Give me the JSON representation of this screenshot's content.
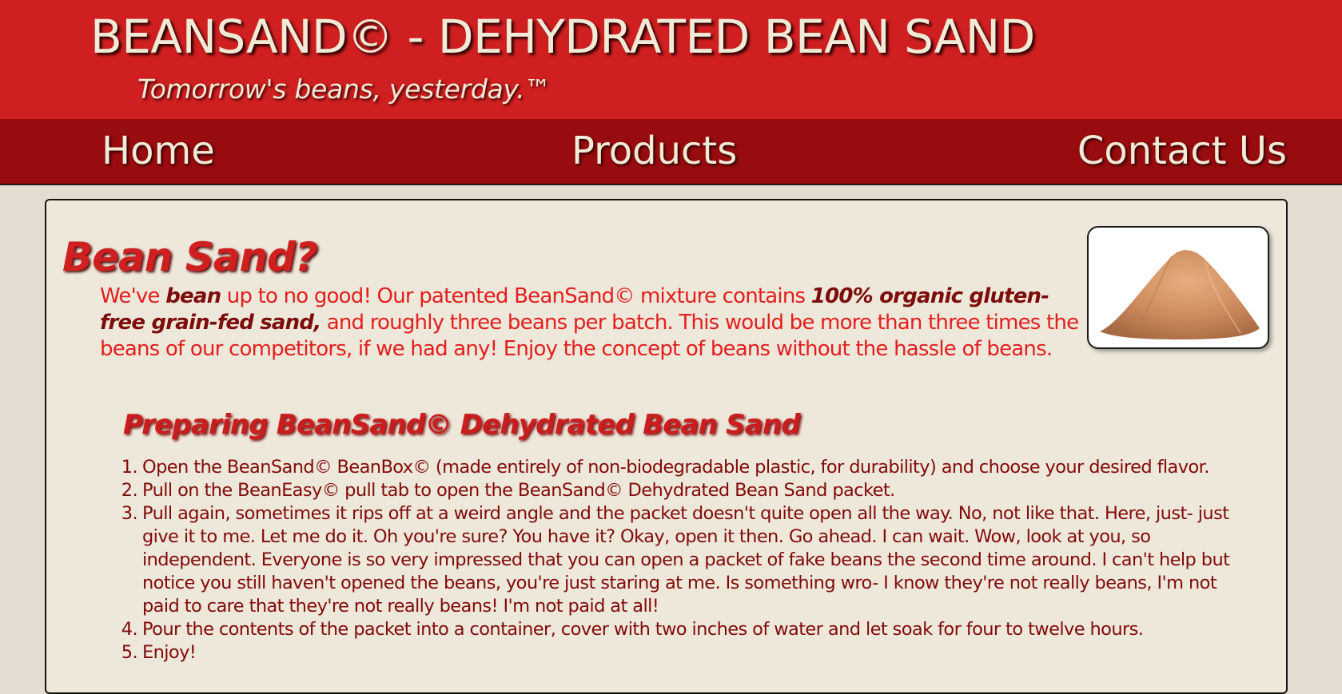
{
  "header": {
    "title": "BEANSAND© - DEHYDRATED BEAN SAND",
    "tagline": "Tomorrow's beans, yesterday.™"
  },
  "nav": {
    "home": "Home",
    "products": "Products",
    "contact": "Contact Us"
  },
  "main": {
    "heading": "Bean Sand?",
    "intro": {
      "t1": "We've ",
      "e1": "bean",
      "t2": " up to no good! Our patented BeanSand© mixture contains ",
      "e2": "100% organic gluten-free grain-fed sand,",
      "t3": " and roughly three beans per batch. This would be more than three times the beans of our competitors, if we had any! Enjoy the concept of beans without the hassle of beans."
    },
    "image_icon": "sand-pile-image",
    "subheading": "Preparing BeanSand© Dehydrated Bean Sand",
    "steps": [
      "Open the BeanSand© BeanBox© (made entirely of non-biodegradable plastic, for durability) and choose your desired flavor.",
      "Pull on the BeanEasy© pull tab to open the BeanSand© Dehydrated Bean Sand packet.",
      "Pull again, sometimes it rips off at a weird angle and the packet doesn't quite open all the way. No, not like that. Here, just- just give it to me. Let me do it. Oh you're sure? You have it? Okay, open it then. Go ahead. I can wait. Wow, look at you, so independent. Everyone is so very impressed that you can open a packet of fake beans the second time around. I can't help but notice you still haven't opened the beans, you're just staring at me. Is something wro- I know they're not really beans, I'm not paid to care that they're not really beans! I'm not paid at all!",
      "Pour the contents of the packet into a container, cover with two inches of water and let soak for four to twelve hours.",
      "Enjoy!"
    ]
  },
  "colors": {
    "banner": "#cf1f20",
    "navbar": "#980b0e",
    "page_bg": "#e2ddd0",
    "content_bg": "#ede8da",
    "header_text": "#f0ead6",
    "heading_red": "#cf1f20",
    "intro_red": "#e41e1e",
    "list_text": "#820a0a"
  }
}
